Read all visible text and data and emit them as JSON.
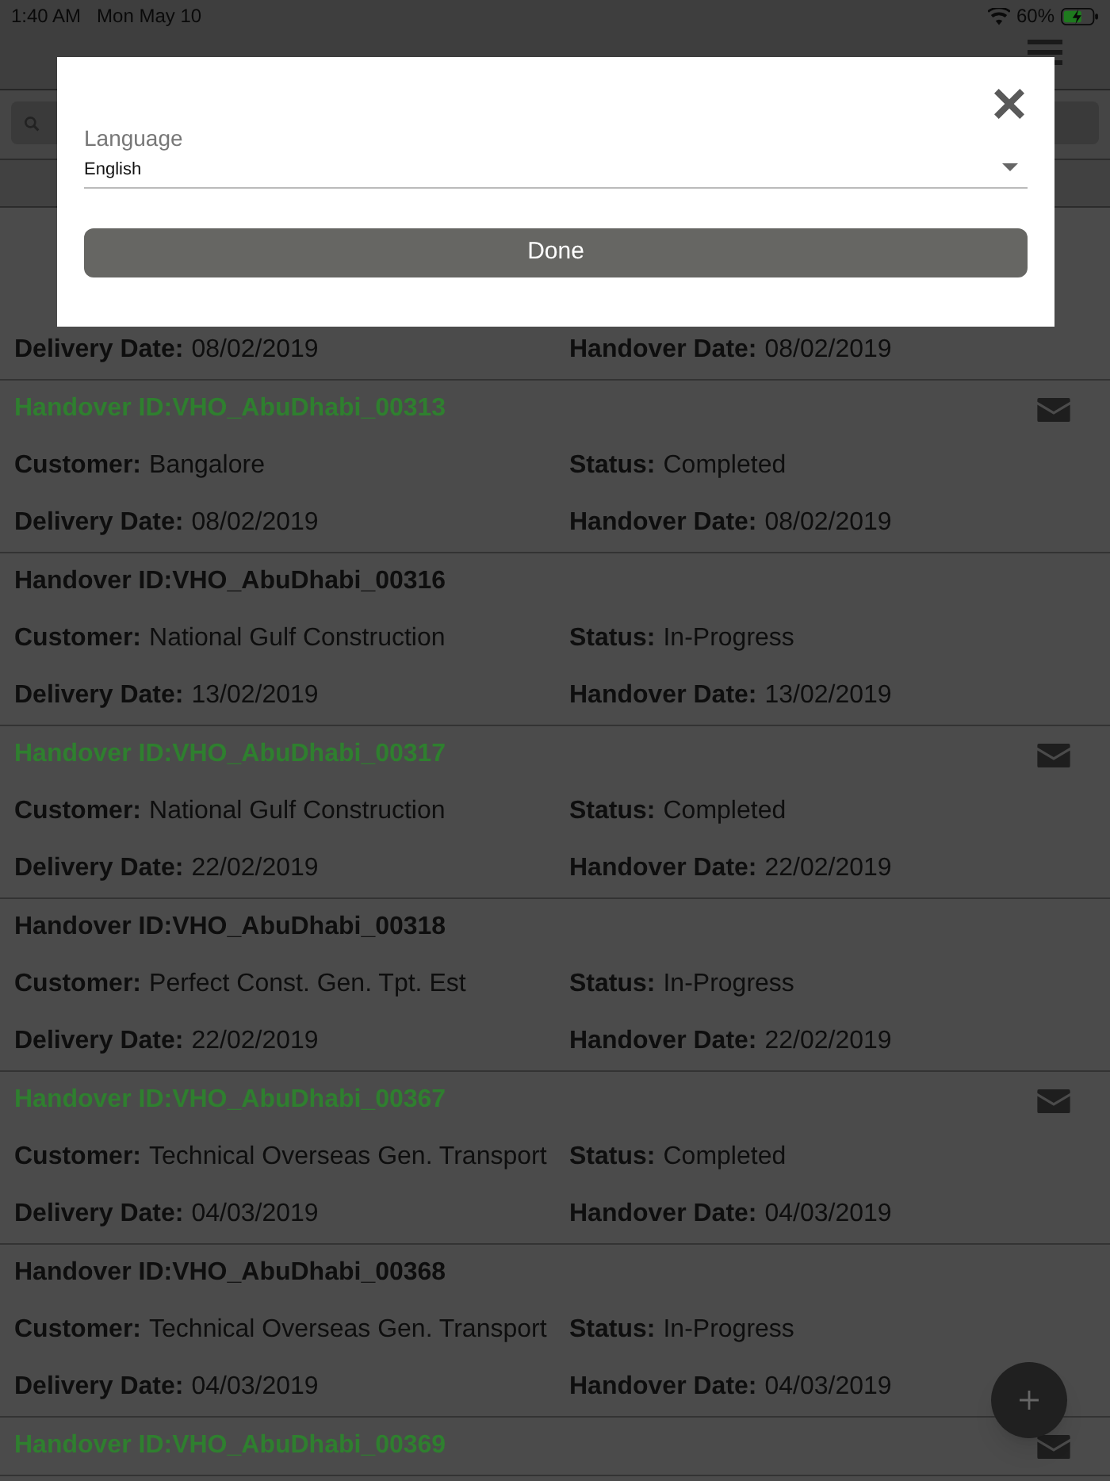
{
  "status_bar": {
    "time": "1:40 AM",
    "date": "Mon May 10",
    "battery": "60%"
  },
  "records": [
    {
      "fields": [
        {
          "label": "Delivery Date:",
          "value": "08/02/2019"
        },
        {
          "label": "Handover Date:",
          "value": "08/02/2019"
        }
      ]
    },
    {
      "sent": true,
      "id": "Handover ID:VHO_AbuDhabi_00313",
      "fields": [
        {
          "label": "Customer:",
          "value": "Bangalore"
        },
        {
          "label": "Status:",
          "value": "Completed"
        },
        {
          "label": "Delivery Date:",
          "value": "08/02/2019"
        },
        {
          "label": "Handover Date:",
          "value": "08/02/2019"
        }
      ]
    },
    {
      "sent": false,
      "id": "Handover ID:VHO_AbuDhabi_00316",
      "fields": [
        {
          "label": "Customer:",
          "value": "National Gulf Construction"
        },
        {
          "label": "Status:",
          "value": "In-Progress"
        },
        {
          "label": "Delivery Date:",
          "value": "13/02/2019"
        },
        {
          "label": "Handover Date:",
          "value": "13/02/2019"
        }
      ]
    },
    {
      "sent": true,
      "id": "Handover ID:VHO_AbuDhabi_00317",
      "fields": [
        {
          "label": "Customer:",
          "value": "National Gulf Construction"
        },
        {
          "label": "Status:",
          "value": "Completed"
        },
        {
          "label": "Delivery Date:",
          "value": "22/02/2019"
        },
        {
          "label": "Handover Date:",
          "value": "22/02/2019"
        }
      ]
    },
    {
      "sent": false,
      "id": "Handover ID:VHO_AbuDhabi_00318",
      "fields": [
        {
          "label": "Customer:",
          "value": "Perfect Const. Gen. Tpt. Est"
        },
        {
          "label": "Status:",
          "value": "In-Progress"
        },
        {
          "label": "Delivery Date:",
          "value": "22/02/2019"
        },
        {
          "label": "Handover Date:",
          "value": "22/02/2019"
        }
      ]
    },
    {
      "sent": true,
      "id": "Handover ID:VHO_AbuDhabi_00367",
      "fields": [
        {
          "label": "Customer:",
          "value": "Technical Overseas Gen. Transport"
        },
        {
          "label": "Status:",
          "value": "Completed"
        },
        {
          "label": "Delivery Date:",
          "value": "04/03/2019"
        },
        {
          "label": "Handover Date:",
          "value": "04/03/2019"
        }
      ]
    },
    {
      "sent": false,
      "id": "Handover ID:VHO_AbuDhabi_00368",
      "fields": [
        {
          "label": "Customer:",
          "value": "Technical Overseas Gen. Transport"
        },
        {
          "label": "Status:",
          "value": "In-Progress"
        },
        {
          "label": "Delivery Date:",
          "value": "04/03/2019"
        },
        {
          "label": "Handover Date:",
          "value": "04/03/2019"
        }
      ]
    },
    {
      "sent": true,
      "id": "Handover ID:VHO_AbuDhabi_00369"
    }
  ],
  "dialog": {
    "field_label": "Language",
    "value": "English",
    "button": "Done"
  }
}
